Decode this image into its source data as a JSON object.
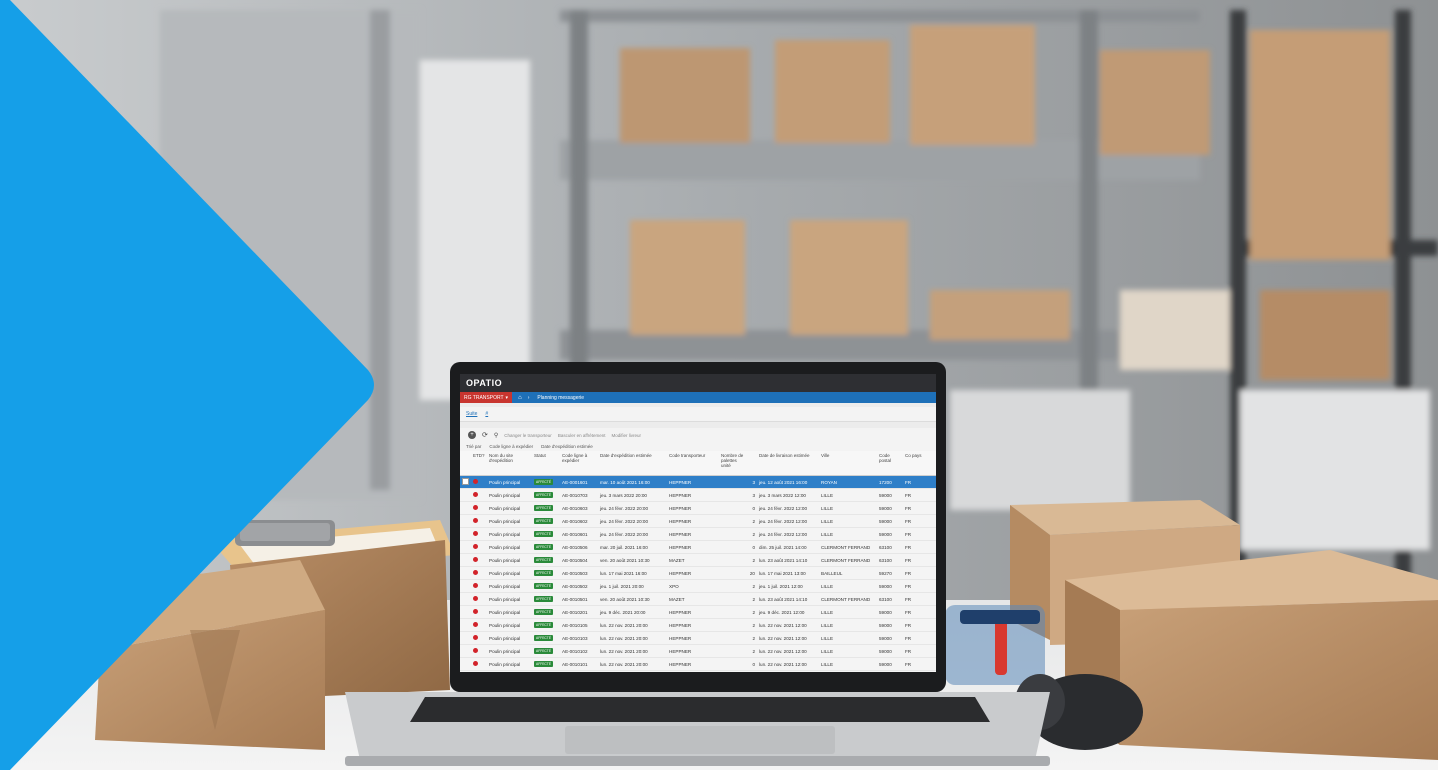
{
  "scene": {
    "accent_color": "#159fe8",
    "objects": [
      "warehouse-shelving",
      "cardboard-box",
      "laptop",
      "tape-dispenser",
      "barcode-scanner",
      "calculator"
    ]
  },
  "app": {
    "logo": "OPATIO",
    "nav_tag": "RG TRANSPORT",
    "breadcrumb": "Planning messagerie",
    "toolbar_links": [
      "Suite",
      "#"
    ],
    "toolbar_actions": [
      "Changer le transporteur",
      "Basculer en affrètement",
      "Modifier livreur"
    ],
    "sort_label": "Trié par",
    "sort_fields": [
      "Code ligne à expédier",
      "Date d'expédition estimée"
    ],
    "columns": [
      "ETD?",
      "Nom du site d'expédition",
      "Statut",
      "Code ligne à expédier",
      "Date d'expédition estimée",
      "Code transporteur",
      "Nombre de palettes",
      "Date de livraison estimée",
      "Ville",
      "Code postal",
      "Co pays"
    ],
    "palettes_unit": "unité",
    "rows": [
      {
        "site": "Poulin principal",
        "statut": "AFFECTÉ",
        "code": "AE-0001601",
        "date_exp": "mar. 10 août 2021 16:00",
        "transp": "HEPPNER",
        "palettes": "3",
        "date_liv": "jeu. 12 août 2021 16:00",
        "ville": "ROYAN",
        "cp": "17200",
        "pays": "FR"
      },
      {
        "site": "Poulin principal",
        "statut": "AFFECTÉ",
        "code": "AE-0010703",
        "date_exp": "jeu. 3 mars 2022 20:00",
        "transp": "HEPPNER",
        "palettes": "3",
        "date_liv": "jeu. 3 mars 2022 12:00",
        "ville": "LILLE",
        "cp": "59000",
        "pays": "FR"
      },
      {
        "site": "Poulin principal",
        "statut": "AFFECTÉ",
        "code": "AE-0010603",
        "date_exp": "jeu. 24 févr. 2022 20:00",
        "transp": "HEPPNER",
        "palettes": "0",
        "date_liv": "jeu. 24 févr. 2022 12:00",
        "ville": "LILLE",
        "cp": "59000",
        "pays": "FR"
      },
      {
        "site": "Poulin principal",
        "statut": "AFFECTÉ",
        "code": "AE-0010602",
        "date_exp": "jeu. 24 févr. 2022 20:00",
        "transp": "HEPPNER",
        "palettes": "2",
        "date_liv": "jeu. 24 févr. 2022 12:00",
        "ville": "LILLE",
        "cp": "59000",
        "pays": "FR"
      },
      {
        "site": "Poulin principal",
        "statut": "AFFECTÉ",
        "code": "AE-0010601",
        "date_exp": "jeu. 24 févr. 2022 20:00",
        "transp": "HEPPNER",
        "palettes": "2",
        "date_liv": "jeu. 24 févr. 2022 12:00",
        "ville": "LILLE",
        "cp": "59000",
        "pays": "FR"
      },
      {
        "site": "Poulin principal",
        "statut": "AFFECTÉ",
        "code": "AE-0010506",
        "date_exp": "mar. 20 juil. 2021 16:00",
        "transp": "HEPPNER",
        "palettes": "0",
        "date_liv": "dim. 25 juil. 2021 14:00",
        "ville": "CLERMONT FERRAND",
        "cp": "63100",
        "pays": "FR"
      },
      {
        "site": "Poulin principal",
        "statut": "AFFECTÉ",
        "code": "AE-0010504",
        "date_exp": "ven. 20 août 2021 10:30",
        "transp": "MAZET",
        "palettes": "2",
        "date_liv": "lun. 23 août 2021 14:10",
        "ville": "CLERMONT FERRAND",
        "cp": "63100",
        "pays": "FR"
      },
      {
        "site": "Poulin principal",
        "statut": "AFFECTÉ",
        "code": "AE-0010503",
        "date_exp": "lun. 17 mai 2021 16:00",
        "transp": "HEPPNER",
        "palettes": "20",
        "date_liv": "lun. 17 mai 2021 13:00",
        "ville": "BAILLEUL",
        "cp": "59270",
        "pays": "FR"
      },
      {
        "site": "Poulin principal",
        "statut": "AFFECTÉ",
        "code": "AE-0010502",
        "date_exp": "jeu. 1 juil. 2021 20:00",
        "transp": "XPO",
        "palettes": "2",
        "date_liv": "jeu. 1 juil. 2021 12:00",
        "ville": "LILLE",
        "cp": "59000",
        "pays": "FR"
      },
      {
        "site": "Poulin principal",
        "statut": "AFFECTÉ",
        "code": "AE-0010501",
        "date_exp": "ven. 20 août 2021 10:30",
        "transp": "MAZET",
        "palettes": "2",
        "date_liv": "lun. 23 août 2021 14:10",
        "ville": "CLERMONT FERRAND",
        "cp": "63100",
        "pays": "FR"
      },
      {
        "site": "Poulin principal",
        "statut": "AFFECTÉ",
        "code": "AE-0010201",
        "date_exp": "jeu. 9 déc. 2021 20:00",
        "transp": "HEPPNER",
        "palettes": "2",
        "date_liv": "jeu. 9 déc. 2021 12:00",
        "ville": "LILLE",
        "cp": "59000",
        "pays": "FR"
      },
      {
        "site": "Poulin principal",
        "statut": "AFFECTÉ",
        "code": "AE-0010105",
        "date_exp": "lun. 22 nov. 2021 20:00",
        "transp": "HEPPNER",
        "palettes": "2",
        "date_liv": "lun. 22 nov. 2021 12:00",
        "ville": "LILLE",
        "cp": "59000",
        "pays": "FR"
      },
      {
        "site": "Poulin principal",
        "statut": "AFFECTÉ",
        "code": "AE-0010103",
        "date_exp": "lun. 22 nov. 2021 20:00",
        "transp": "HEPPNER",
        "palettes": "2",
        "date_liv": "lun. 22 nov. 2021 12:00",
        "ville": "LILLE",
        "cp": "59000",
        "pays": "FR"
      },
      {
        "site": "Poulin principal",
        "statut": "AFFECTÉ",
        "code": "AE-0010102",
        "date_exp": "lun. 22 nov. 2021 20:00",
        "transp": "HEPPNER",
        "palettes": "2",
        "date_liv": "lun. 22 nov. 2021 12:00",
        "ville": "LILLE",
        "cp": "59000",
        "pays": "FR"
      },
      {
        "site": "Poulin principal",
        "statut": "AFFECTÉ",
        "code": "AE-0010101",
        "date_exp": "lun. 22 nov. 2021 20:00",
        "transp": "HEPPNER",
        "palettes": "0",
        "date_liv": "lun. 22 nov. 2021 12:00",
        "ville": "LILLE",
        "cp": "59000",
        "pays": "FR"
      },
      {
        "site": "Poulin principal",
        "statut": "AFFECTÉ",
        "code": "AE-0010007",
        "date_exp": "sam. 2 oct. 2021 20:30",
        "transp": "MAZET",
        "palettes": "4",
        "date_liv": "mar. 6 oct. 2021 09:15",
        "ville": "CLERMONT FERRAND",
        "cp": "63100",
        "pays": "FR"
      }
    ]
  }
}
